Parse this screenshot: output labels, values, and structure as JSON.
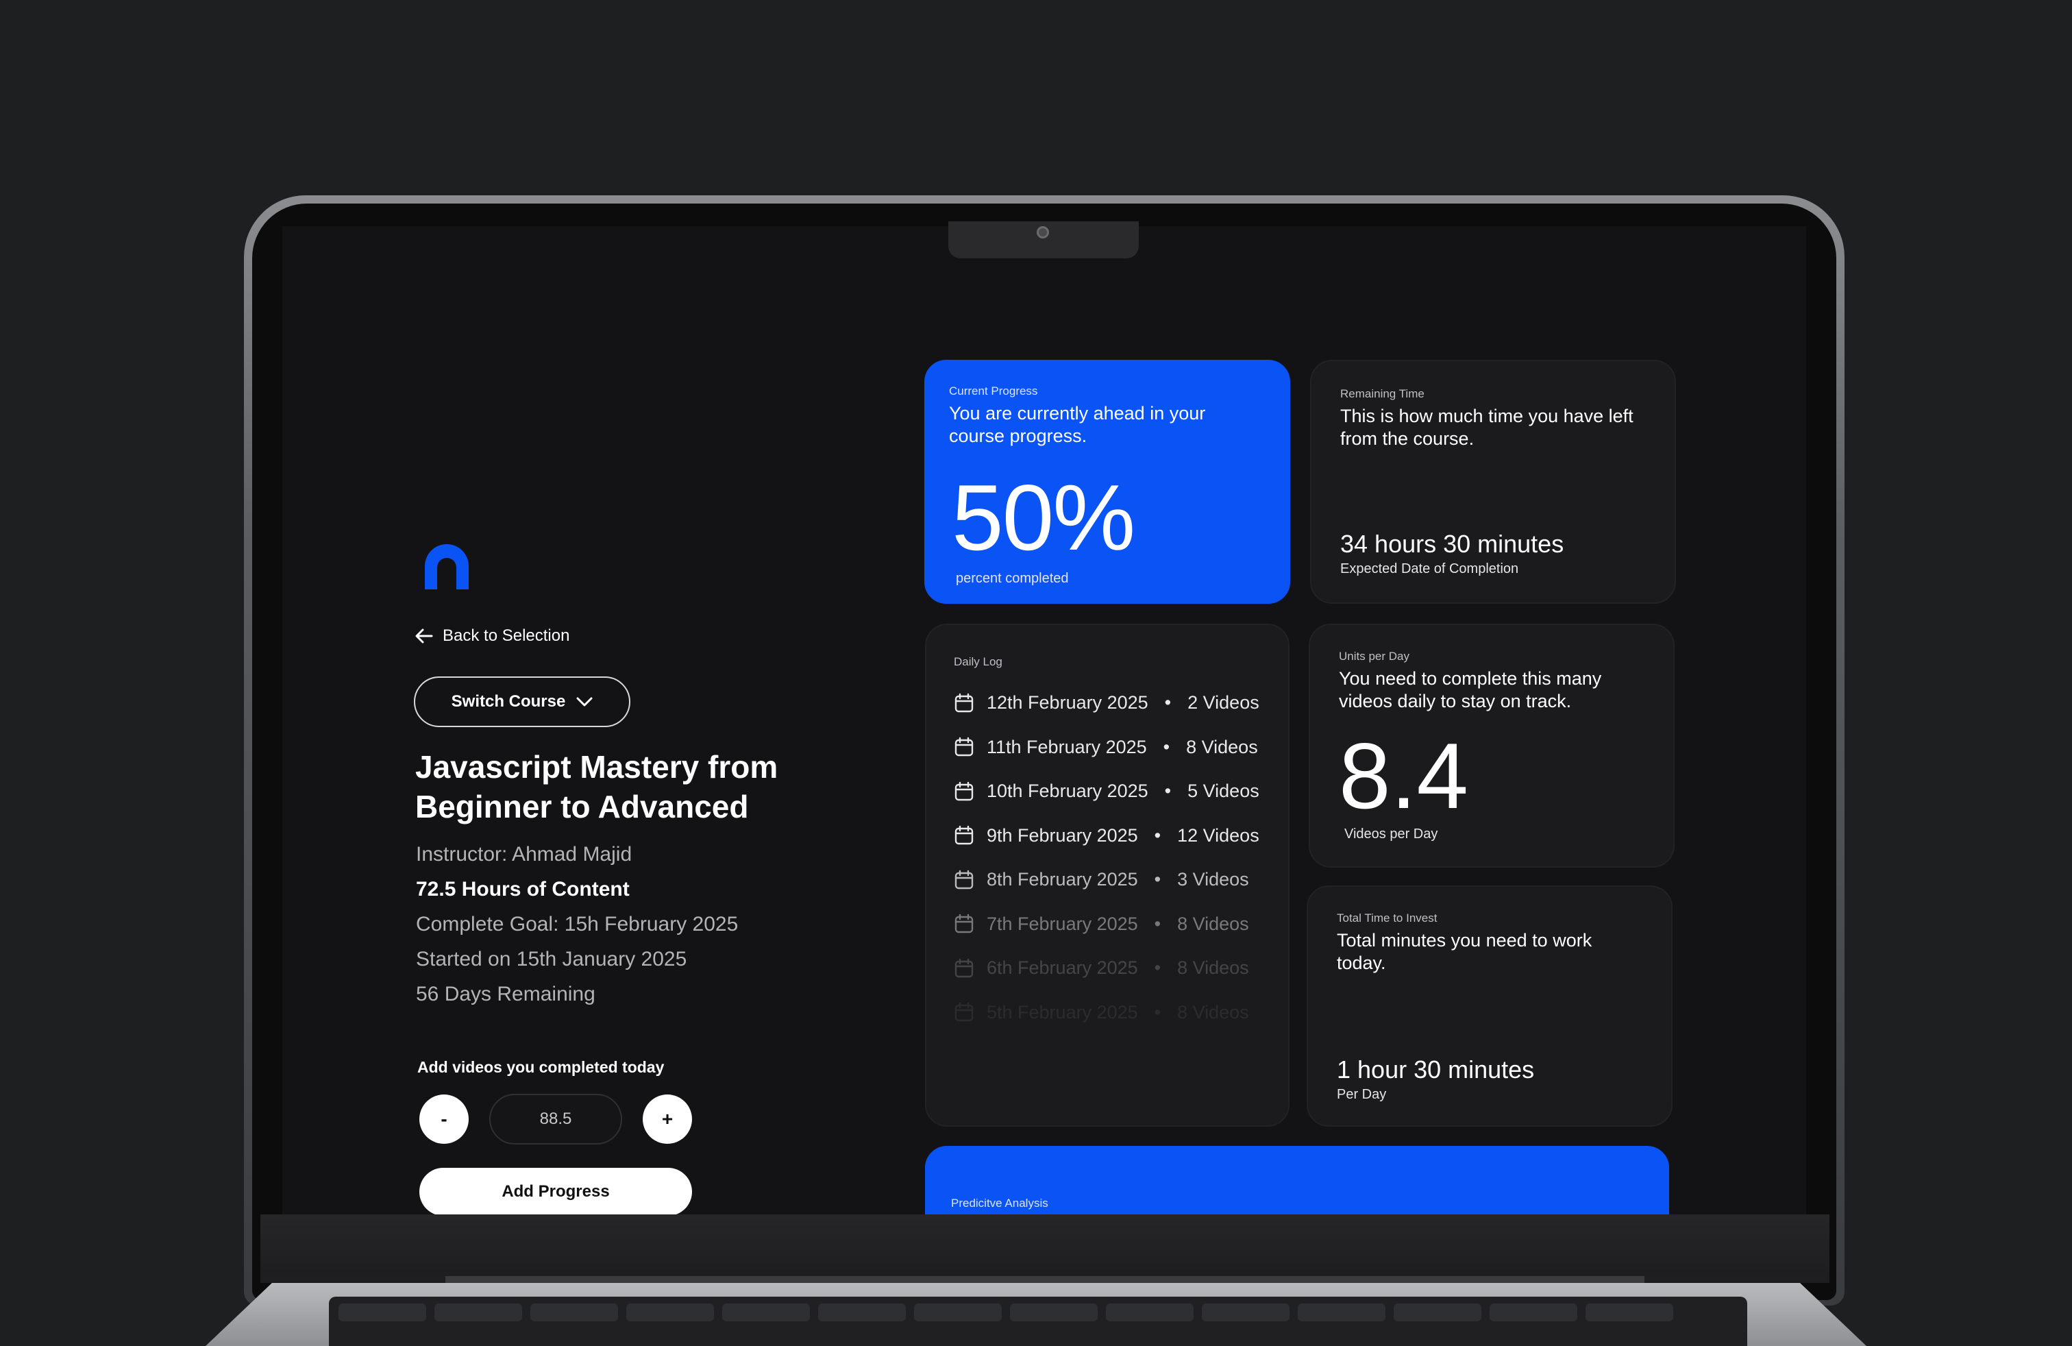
{
  "sidebar": {
    "back_label": "Back to Selection",
    "switch_label": "Switch Course",
    "course_title": "Javascript Mastery from Beginner to Advanced",
    "instructor": "Instructor: Ahmad Majid",
    "hours": "72.5 Hours of Content",
    "goal": "Complete Goal: 15h February 2025",
    "started": "Started on 15th January 2025",
    "remaining": "56 Days Remaining",
    "add_label": "Add videos you completed today",
    "minus_label": "-",
    "plus_label": "+",
    "quantity_value": "88.5",
    "add_progress_label": "Add Progress"
  },
  "current_progress": {
    "label": "Current Progress",
    "description": "You are currently ahead in your course progress.",
    "value": "50%",
    "unit": "percent completed",
    "percent": 50
  },
  "remaining_time": {
    "label": "Remaining Time",
    "description": "This is how much time you have left from the course.",
    "value": "34 hours 30 minutes",
    "unit": "Expected Date of Completion"
  },
  "daily_log": {
    "label": "Daily Log",
    "items": [
      {
        "date": "12th February 2025",
        "separator": "•",
        "count": "2 Videos"
      },
      {
        "date": "11th February 2025",
        "separator": "•",
        "count": "8 Videos"
      },
      {
        "date": "10th February 2025",
        "separator": "•",
        "count": "5 Videos"
      },
      {
        "date": "9th February 2025",
        "separator": "•",
        "count": "12 Videos"
      },
      {
        "date": "8th February 2025",
        "separator": "•",
        "count": "3 Videos"
      },
      {
        "date": "7th February 2025",
        "separator": "•",
        "count": "8 Videos"
      },
      {
        "date": "6th February 2025",
        "separator": "•",
        "count": "8 Videos"
      },
      {
        "date": "5th February 2025",
        "separator": "•",
        "count": "8 Videos"
      }
    ]
  },
  "units_per_day": {
    "label": "Units per Day",
    "description": "You need to complete this many videos daily to stay on track.",
    "value": "8.4",
    "unit": "Videos per Day"
  },
  "total_time": {
    "label": "Total Time to Invest",
    "description": "Total minutes you need to work today.",
    "value": "1 hour 30 minutes",
    "unit": "Per Day"
  },
  "predictive": {
    "label": "Predicitve Analysis"
  },
  "colors": {
    "accent": "#0a53f5",
    "background": "#131315",
    "card": "#1b1b1d"
  },
  "icons": {
    "back": "arrow-left-icon",
    "switch": "chevron-down-icon",
    "log": "calendar-icon",
    "logo": "arch-logo-icon"
  }
}
